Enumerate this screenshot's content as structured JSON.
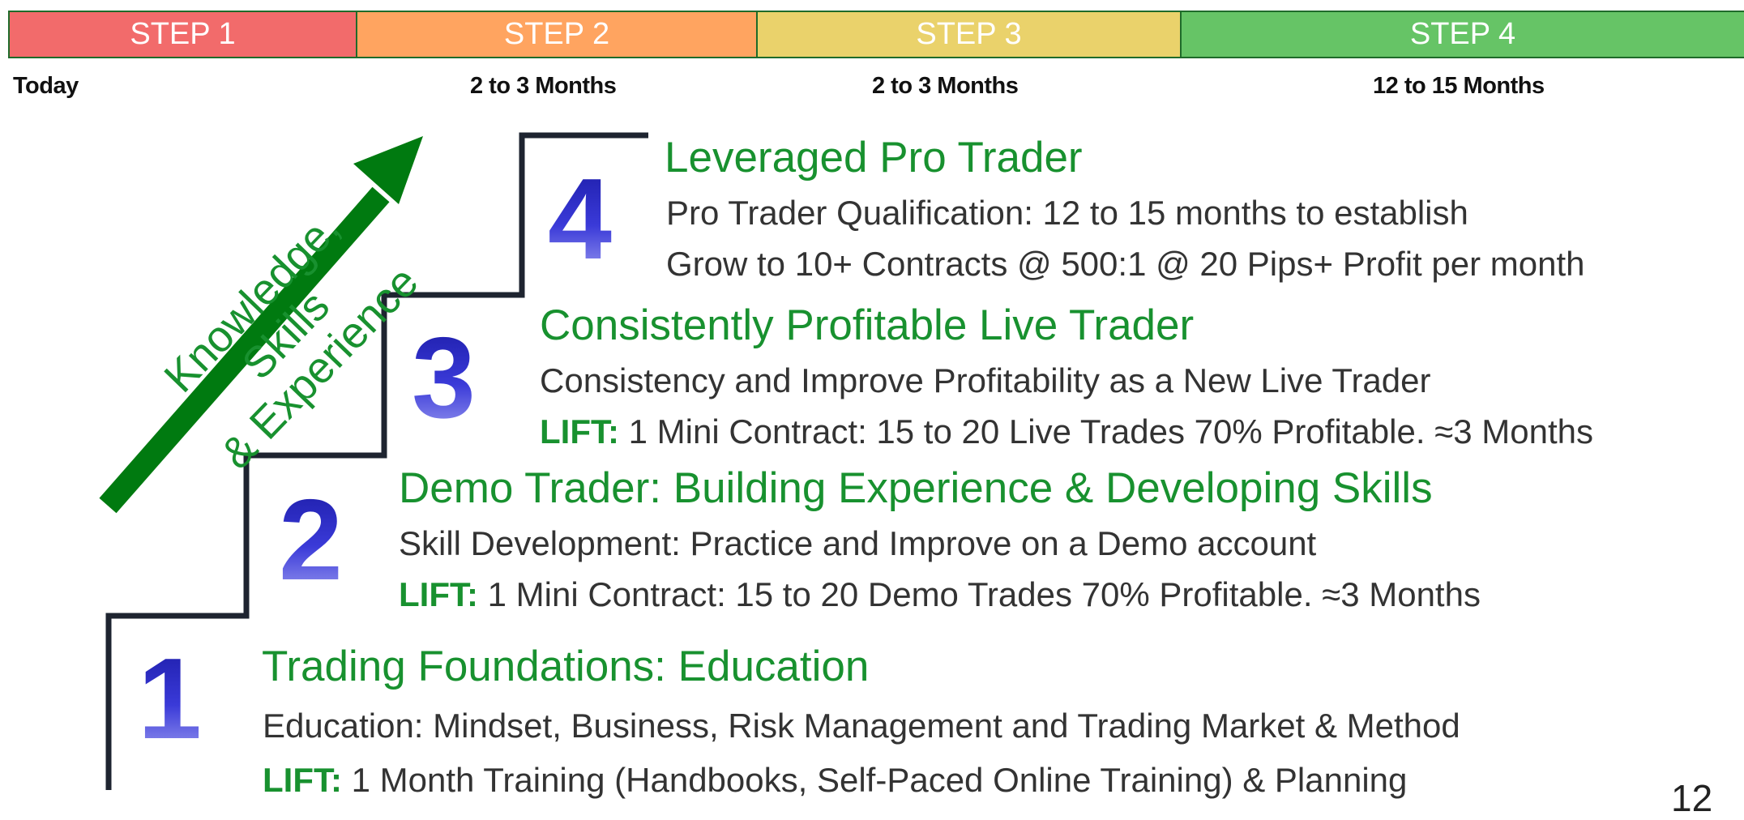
{
  "steps": [
    {
      "label": "STEP 1",
      "color": "#f26b6b",
      "duration": "Today"
    },
    {
      "label": "STEP 2",
      "color": "#ffa460",
      "duration": "2 to 3 Months"
    },
    {
      "label": "STEP 3",
      "color": "#ead26b",
      "duration": "2 to 3 Months"
    },
    {
      "label": "STEP 4",
      "color": "#66c466",
      "duration": "12 to 15 Months"
    }
  ],
  "arrow": {
    "label_line1": "Knowledge, Skills",
    "label_line2": "& Experience",
    "color": "#007a10"
  },
  "levels": [
    {
      "number": "4",
      "title": "Leveraged Pro Trader",
      "line1": "Pro Trader Qualification: 12 to 15 months to establish",
      "line2": "Grow to 10+ Contracts @ 500:1 @ 20 Pips+ Profit per month"
    },
    {
      "number": "3",
      "title": "Consistently Profitable Live Trader",
      "line1": "Consistency and Improve Profitability as a New Live Trader",
      "lift_label": "LIFT:",
      "line2": " 1 Mini Contract: 15 to 20 Live Trades 70% Profitable. ≈3 Months"
    },
    {
      "number": "2",
      "title": "Demo Trader: Building Experience & Developing Skills",
      "line1": "Skill Development: Practice and Improve on a Demo account",
      "lift_label": "LIFT:",
      "line2": " 1 Mini Contract: 15 to 20 Demo Trades 70% Profitable. ≈3 Months"
    },
    {
      "number": "1",
      "title": "Trading Foundations: Education",
      "line1": "Education: Mindset, Business, Risk Management and Trading Market & Method",
      "lift_label": "LIFT:",
      "line2": " 1 Month Training (Handbooks, Self-Paced Online Training) & Planning"
    }
  ],
  "page_number": "12",
  "accent_green": "#18912f",
  "number_color": "#2a2ac8"
}
